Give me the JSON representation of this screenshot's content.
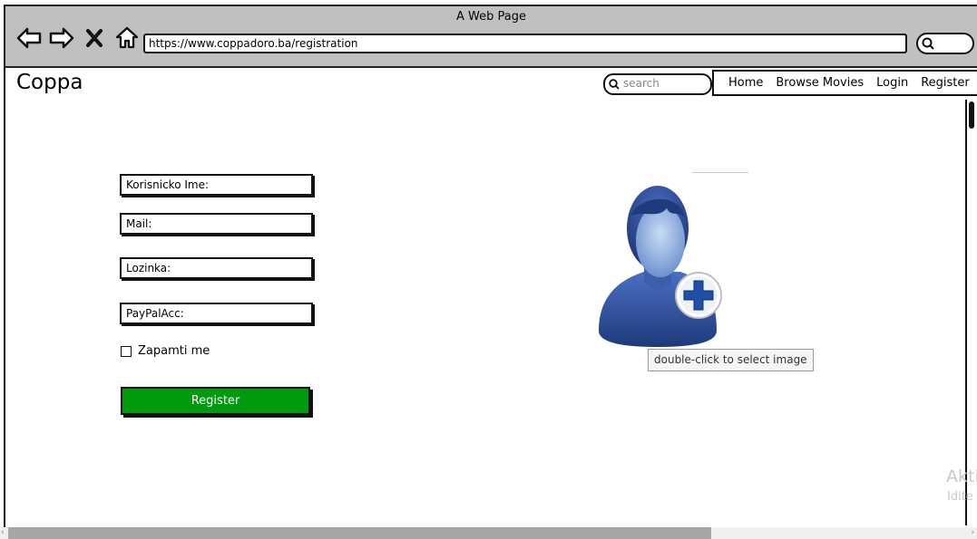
{
  "browser": {
    "window_title": "A Web Page",
    "url": "https://www.coppadoro.ba/registration"
  },
  "header": {
    "logo": "Coppa",
    "search_placeholder": "search",
    "nav": [
      "Home",
      "Browse Movies",
      "Login",
      "Register"
    ]
  },
  "form": {
    "username_label": "Korisnicko Ime:",
    "mail_label": "Mail:",
    "password_label": "Lozinka:",
    "paypal_label": "PayPalAcc:",
    "remember_label": "Zapamti me",
    "register_button": "Register"
  },
  "avatar": {
    "tooltip": "double-click to select image"
  },
  "watermark": {
    "line1": "Akti",
    "line2": "Idite"
  },
  "colors": {
    "register_button": "#009a0f",
    "avatar_blue": "#2d4f9c",
    "chrome": "#c0c0c0"
  }
}
